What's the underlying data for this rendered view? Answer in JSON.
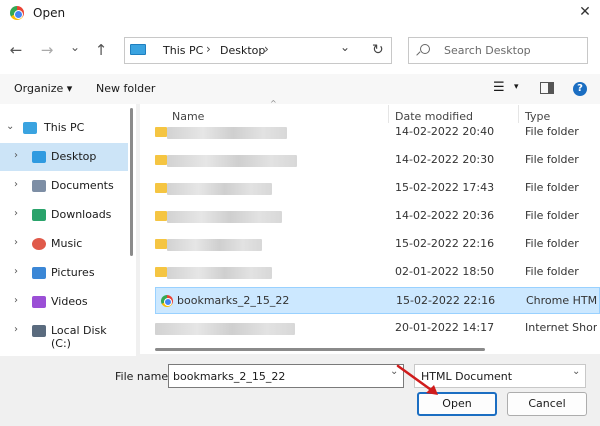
{
  "window": {
    "title": "Open",
    "close_glyph": "✕"
  },
  "nav": {
    "back": "←",
    "forward": "→",
    "recent": "⌄",
    "up": "↑",
    "refresh": "↻"
  },
  "address": {
    "segments": [
      "This PC",
      "Desktop"
    ],
    "separator": "›",
    "dropdown": "⌄"
  },
  "search": {
    "placeholder": "Search Desktop"
  },
  "toolbar": {
    "organize": "Organize ▾",
    "new_folder": "New folder",
    "view_glyph": "☰",
    "view_drop": "▾",
    "help": "?"
  },
  "nav_pane": {
    "items": [
      {
        "label": "This PC",
        "icon": "pc-icon",
        "color": "#3aa3e0"
      },
      {
        "label": "Desktop",
        "icon": "desktop-icon",
        "color": "#2f9ae0",
        "selected": true
      },
      {
        "label": "Documents",
        "icon": "documents-icon",
        "color": "#7d8ea5"
      },
      {
        "label": "Downloads",
        "icon": "downloads-icon",
        "color": "#2aa36b"
      },
      {
        "label": "Music",
        "icon": "music-icon",
        "color": "#e05a4a"
      },
      {
        "label": "Pictures",
        "icon": "pictures-icon",
        "color": "#3b87d6"
      },
      {
        "label": "Videos",
        "icon": "videos-icon",
        "color": "#9b4fd6"
      },
      {
        "label": "Local Disk (C:)",
        "icon": "disk-icon",
        "color": "#5a6b7e"
      }
    ],
    "expand_glyph": "›",
    "collapse_glyph": "⌄"
  },
  "file_list": {
    "columns": [
      "Name",
      "Date modified",
      "Type"
    ],
    "rows": [
      {
        "name": "",
        "date": "14-02-2022 20:40",
        "type": "File folder",
        "kind": "folder"
      },
      {
        "name": "",
        "date": "14-02-2022 20:30",
        "type": "File folder",
        "kind": "folder"
      },
      {
        "name": "",
        "date": "15-02-2022 17:43",
        "type": "File folder",
        "kind": "folder"
      },
      {
        "name": "",
        "date": "14-02-2022 20:36",
        "type": "File folder",
        "kind": "folder"
      },
      {
        "name": "",
        "date": "15-02-2022 22:16",
        "type": "File folder",
        "kind": "folder"
      },
      {
        "name": "",
        "date": "02-01-2022 18:50",
        "type": "File folder",
        "kind": "folder"
      },
      {
        "name": "bookmarks_2_15_22",
        "date": "15-02-2022 22:16",
        "type": "Chrome HTM",
        "kind": "chrome",
        "selected": true
      },
      {
        "name": "",
        "date": "20-01-2022 14:17",
        "type": "Internet Shor",
        "kind": "blank"
      }
    ]
  },
  "footer": {
    "file_name_label": "File name:",
    "file_name_value": "bookmarks_2_15_22",
    "file_type_value": "HTML Document",
    "open_label": "Open",
    "cancel_label": "Cancel"
  },
  "colors": {
    "selection": "#cce8ff",
    "accent": "#1b6ec2",
    "arrow": "#d01c1c"
  }
}
